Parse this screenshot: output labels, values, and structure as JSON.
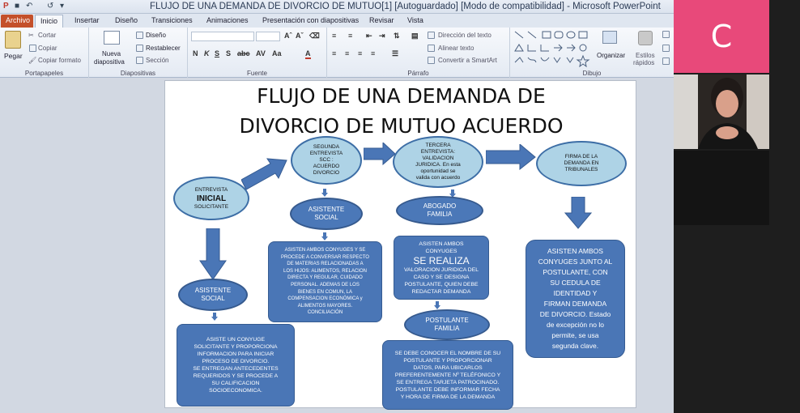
{
  "window": {
    "title": "FLUJO DE UNA DEMANDA DE DIVORCIO DE MUTUO[1] [Autoguardado] [Modo de compatibilidad] - Microsoft PowerPoint"
  },
  "tabs": [
    "Archivo",
    "Inicio",
    "Insertar",
    "Diseño",
    "Transiciones",
    "Animaciones",
    "Presentación con diapositivas",
    "Revisar",
    "Vista"
  ],
  "ribbon": {
    "portapapeles": {
      "pegar": "Pegar",
      "cortar": "Cortar",
      "copiar": "Copiar",
      "copiar_formato": "Copiar formato",
      "label": "Portapapeles"
    },
    "diapositivas": {
      "nueva_1": "Nueva",
      "nueva_2": "diapositiva",
      "diseno": "Diseño",
      "restablecer": "Restablecer",
      "seccion": "Sección",
      "label": "Diapositivas"
    },
    "fuente": {
      "label": "Fuente"
    },
    "parrafo": {
      "direccion": "Dirección del texto",
      "alinear": "Alinear texto",
      "smartart": "Convertir a SmartArt",
      "label": "Párrafo"
    },
    "dibujo": {
      "organizar": "Organizar",
      "estilos_1": "Estilos",
      "estilos_2": "rápidos",
      "label": "Dibujo"
    }
  },
  "slide": {
    "title_line1": "FLUJO DE UNA DEMANDA DE",
    "title_line2": "DIVORCIO DE MUTUO ACUERDO",
    "entrevista_inicial": {
      "l1": "ENTREVISTA",
      "l2": "INICIAL",
      "l3": "SOLICITANTE"
    },
    "segunda_entrevista": {
      "l1": "SEGUNDA",
      "l2": "ENTREVISTA",
      "l3": "SCC :",
      "l4": "ACUERDO",
      "l5": "DIVORCIO"
    },
    "tercera_entrevista": {
      "l1": "TERCERA",
      "l2": "ENTREVISTA:",
      "l3": "VALIDACION",
      "l4": "JURIDICA. En esta",
      "l5": "oportunidad se",
      "l6": "valida con acuerdo"
    },
    "firma": {
      "l1": "FIRMA DE LA",
      "l2": "DEMANDA EN",
      "l3": "TRIBUNALES"
    },
    "asistente_social_1": {
      "l1": "ASISTENTE",
      "l2": "SOCIAL"
    },
    "asistente_social_2": {
      "l1": "ASISTENTE",
      "l2": "SOCIAL"
    },
    "abogado_familia": {
      "l1": "ABOGADO",
      "l2": "FAMILIA"
    },
    "postulante_familia": {
      "l1": "POSTULANTE",
      "l2": "FAMILIA"
    },
    "box_asiste": [
      "ASISTE UN CONYUGE",
      "SOLICITANTE Y PROPORCIONA",
      "INFORMACION PARA INICIAR",
      "PROCESO DE DIVORCIO.",
      "SE ENTREGAN  ANTECEDENTES",
      "REQUERIDOS Y SE PROCEDE A",
      "SU CALIFICACION",
      "SOCIOECONOMICA."
    ],
    "box_conyuges": [
      "ASISTEN AMBOS CONYUGES Y SE",
      "PROCEDE A CONVERSAR RESPECTO",
      "DE MATERIAS RELACIONADAS A",
      "LOS HIJOS: ALIMENTOS,  RELACION",
      "DIRECTA Y REGULAR, CUIDADO",
      "PERSONAL. ADEMAS DE  LOS",
      "BIENES EN COMUN, LA",
      "COMPENSACION ECONÓMICA  y",
      "ALIMENTOS  MAYORES.",
      "CONCILIACIÓN"
    ],
    "box_realiza": {
      "l1": "ASISTEN AMBOS",
      "l2": "CONYUGES",
      "big": "SE REALIZA",
      "l3": "VALORACION JURIDICA DEL",
      "l4": "CASO Y SE DESIGNA",
      "l5": "POSTULANTE, QUIEN DEBE",
      "l6": "REDACTAR DEMANDA"
    },
    "box_postulante": [
      "SE DEBE CONOCER EL NOMBRE DE SU",
      "POSTULANTE Y PROPORCIONAR",
      "DATOS, PARA UBICARLOS",
      "PREFERENTEMENTE Nº TELÉFONICO Y",
      "SE ENTREGA TARJETA PATROCINADO.",
      "POSTULANTE DEBE INFORMAR FECHA",
      "Y HORA DE FIRMA DE LA DEMANDA"
    ],
    "box_firman": [
      "ASISTEN AMBOS",
      "CONYUGES  JUNTO AL",
      "POSTULANTE,  CON",
      "SU CEDULA DE",
      "IDENTIDAD Y",
      "FIRMAN  DEMANDA",
      "DE DIVORCIO. Estado",
      "de excepción no lo",
      "permite, se usa",
      "segunda clave."
    ]
  },
  "participants": {
    "initial": "C"
  },
  "colors": {
    "accent_file": "#c4502a",
    "box_fill": "#4a76b6",
    "ellipse_fill": "#aed3e6",
    "arrow_fill": "#4a76b6",
    "avatar_bg": "#e8497a"
  }
}
